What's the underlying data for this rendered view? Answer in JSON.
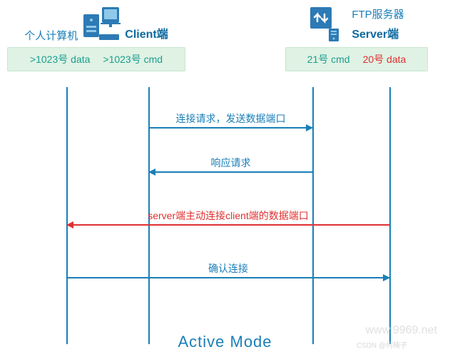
{
  "left": {
    "cn_label": "个人计算机",
    "role": "Client端",
    "ports": [
      ">1023号 data",
      ">1023号 cmd"
    ]
  },
  "right": {
    "cn_label": "FTP服务器",
    "role": "Server端",
    "ports": [
      "21号 cmd",
      "20号 data"
    ]
  },
  "arrows": [
    {
      "label": "连接请求，发送数据端口"
    },
    {
      "label": "响应请求"
    },
    {
      "label": "server端主动连接client端的数据端口"
    },
    {
      "label": "确认连接"
    }
  ],
  "title": "Active Mode",
  "watermark1": "www.9969.net",
  "watermark2": "CSDN @何楠子"
}
